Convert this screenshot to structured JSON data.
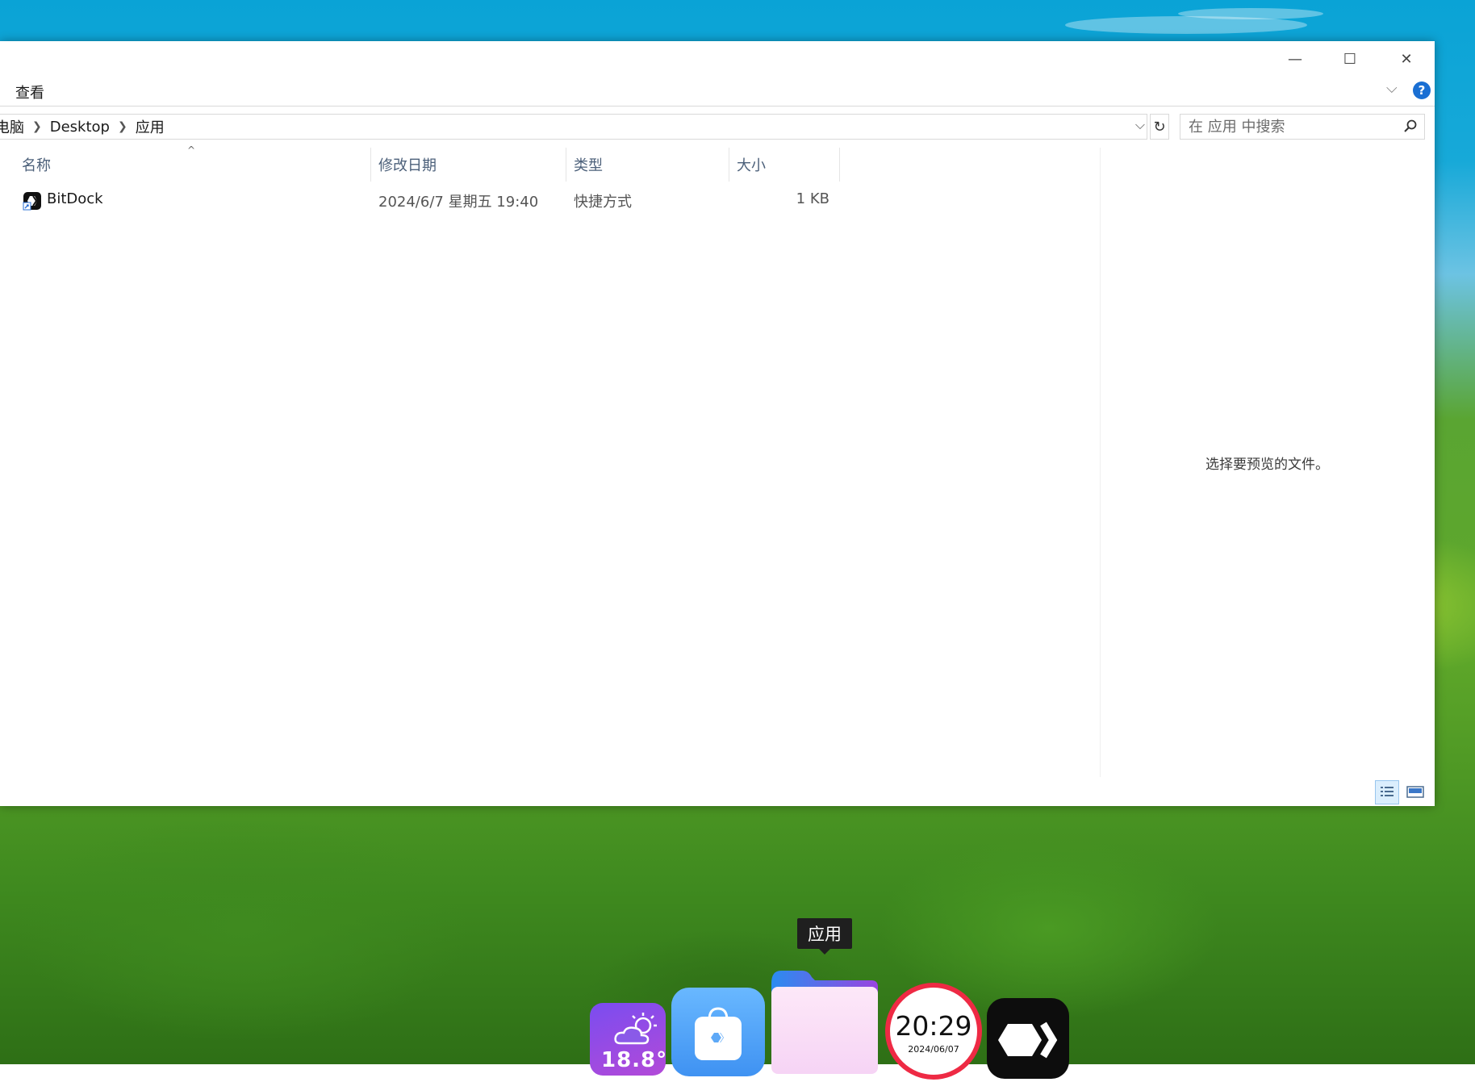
{
  "window": {
    "ribbon_tab": "查看",
    "controls": {
      "minimize": "—",
      "maximize": "☐",
      "close": "✕"
    },
    "help": "?"
  },
  "address": {
    "crumbs": [
      "电脑",
      "Desktop",
      "应用"
    ],
    "search_placeholder": "在 应用 中搜索"
  },
  "columns": {
    "name": "名称",
    "modified": "修改日期",
    "type": "类型",
    "size": "大小"
  },
  "files": [
    {
      "name": "BitDock",
      "modified": "2024/6/7 星期五 19:40",
      "type": "快捷方式",
      "size": "1 KB"
    }
  ],
  "preview": {
    "empty_text": "选择要预览的文件。"
  },
  "dock": {
    "tooltip": "应用",
    "weather_temp": "18.8°",
    "clock_time": "20:29",
    "clock_date": "2024/06/07",
    "items": [
      "weather",
      "app-store",
      "folder-应用",
      "clock",
      "bitdock"
    ]
  },
  "colors": {
    "accent_blue": "#1a6fd3",
    "clock_ring": "#ee2a44",
    "weather_bg": "#7a4cf0",
    "store_bg": "#3f92f2"
  }
}
